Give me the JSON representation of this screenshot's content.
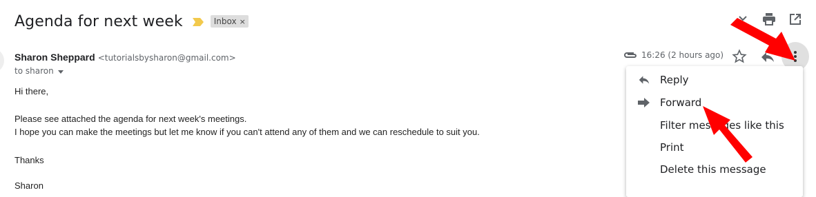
{
  "email": {
    "subject": "Agenda for next week",
    "label": "Inbox",
    "label_remove": "×",
    "sender_name": "Sharon Sheppard",
    "sender_email": "<tutorialsbysharon@gmail.com>",
    "recipient": "to sharon",
    "timestamp": "16:26 (2 hours ago)",
    "body": {
      "greeting": "Hi there,",
      "line1": "Please see attached the agenda for next week's meetings.",
      "line2": "I hope you can make the meetings but let me know if you can't attend any of them and we can reschedule to suit you.",
      "closing": "Thanks",
      "signature_partial": "Sharon"
    }
  },
  "menu": {
    "items": [
      {
        "label": "Reply",
        "icon": "reply-icon"
      },
      {
        "label": "Forward",
        "icon": "forward-icon"
      },
      {
        "label": "Filter messages like this",
        "icon": ""
      },
      {
        "label": "Print",
        "icon": ""
      },
      {
        "label": "Delete this message",
        "icon": ""
      }
    ]
  },
  "colors": {
    "importance": "#f2c94c",
    "annotation_arrow": "#ff0000",
    "icon_gray": "#5f6368"
  }
}
